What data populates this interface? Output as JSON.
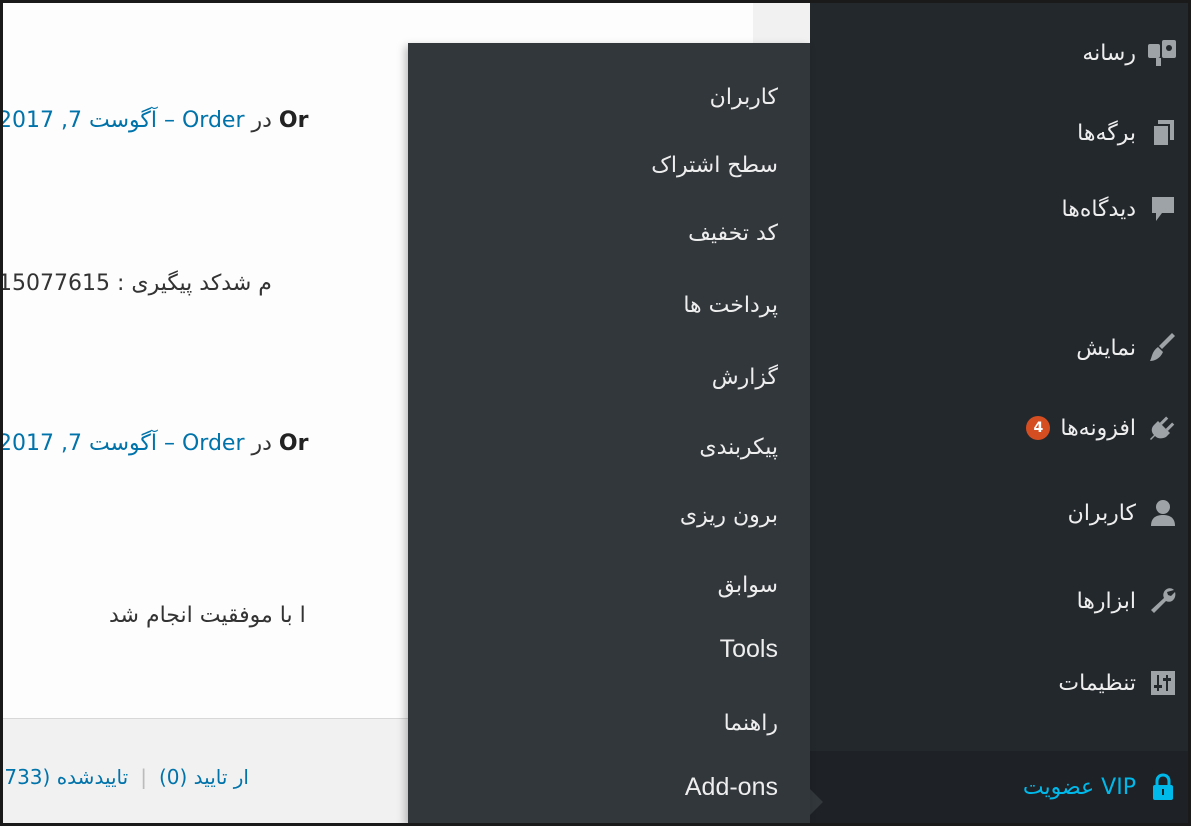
{
  "content": {
    "lines": [
      {
        "bold": "Or",
        "mid": " در ",
        "link": "Order – آگوست 7, 2017"
      },
      {
        "text": "م شدکد پیگیری : 15077615"
      },
      {
        "bold": "Or",
        "mid": " در ",
        "link": "Order – آگوست 7, 2017"
      },
      {
        "text": "ا با موفقیت انجام شد"
      }
    ],
    "status": {
      "pending": "ار تایید (0)",
      "approved": "تاییدشده (733,"
    }
  },
  "sidebar": {
    "items": [
      {
        "label": "رسانه",
        "icon": "media-icon"
      },
      {
        "label": "برگه‌ها",
        "icon": "pages-icon"
      },
      {
        "label": "دیدگاه‌ها",
        "icon": "comments-icon"
      },
      {
        "label": "نمایش",
        "icon": "appearance-icon"
      },
      {
        "label": "افزونه‌ها",
        "icon": "plugins-icon",
        "badge": "4"
      },
      {
        "label": "کاربران",
        "icon": "users-icon"
      },
      {
        "label": "ابزارها",
        "icon": "tools-icon"
      },
      {
        "label": "تنظیمات",
        "icon": "settings-icon"
      }
    ],
    "current": {
      "label": "عضویت VIP",
      "icon": "lock-icon"
    }
  },
  "flyout": {
    "items": [
      "کاربران",
      "سطح اشتراک",
      "کد تخفیف",
      "پرداخت ها",
      "گزارش",
      "پیکربندی",
      "برون ریزی",
      "سوابق",
      "Tools",
      "راهنما",
      "Add-ons"
    ]
  },
  "colors": {
    "sidebar_bg": "#23282d",
    "flyout_bg": "#32373c",
    "link": "#0073aa",
    "current": "#00b9eb",
    "badge": "#d54e21"
  }
}
